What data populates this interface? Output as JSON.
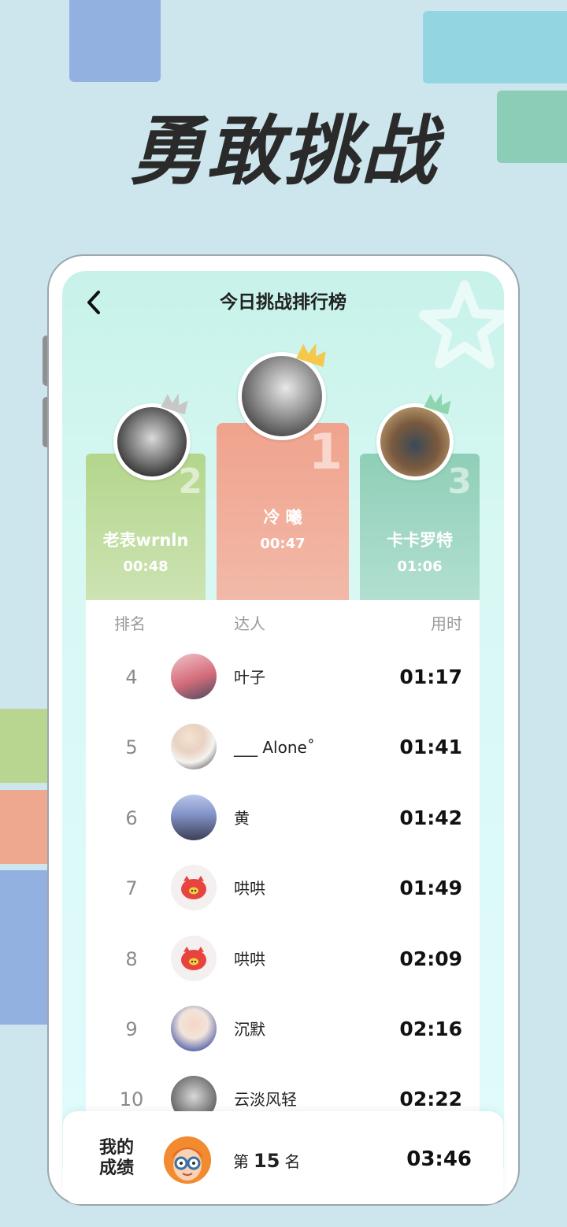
{
  "hero": {
    "title": "勇敢挑战"
  },
  "nav": {
    "title": "今日挑战排行榜"
  },
  "top3": [
    {
      "rank": "1",
      "name": "冷 曦",
      "time": "00:47"
    },
    {
      "rank": "2",
      "name": "老表wrnln",
      "time": "00:48"
    },
    {
      "rank": "3",
      "name": "卡卡罗特",
      "time": "01:06"
    }
  ],
  "list": {
    "headers": {
      "rank": "排名",
      "user": "达人",
      "time": "用时"
    },
    "rows": [
      {
        "rank": "4",
        "name": "叶子",
        "time": "01:17"
      },
      {
        "rank": "5",
        "name": "___ Alone˚",
        "time": "01:41"
      },
      {
        "rank": "6",
        "name": "黄",
        "time": "01:42"
      },
      {
        "rank": "7",
        "name": "哄哄",
        "time": "01:49"
      },
      {
        "rank": "8",
        "name": "哄哄",
        "time": "02:09"
      },
      {
        "rank": "9",
        "name": "沉默",
        "time": "02:16"
      },
      {
        "rank": "10",
        "name": "云淡风轻",
        "time": "02:22"
      }
    ]
  },
  "my_score": {
    "label": "我的成绩",
    "rank_prefix": "第",
    "rank": "15",
    "rank_suffix": "名",
    "time": "03:46"
  },
  "colors": {
    "gold": "#f5c84b",
    "silver": "#c7c7c7",
    "bronze": "#8fd6b0",
    "podium1": "#f0a38d",
    "podium2": "#b3d68c",
    "podium3": "#8fcfb7"
  }
}
